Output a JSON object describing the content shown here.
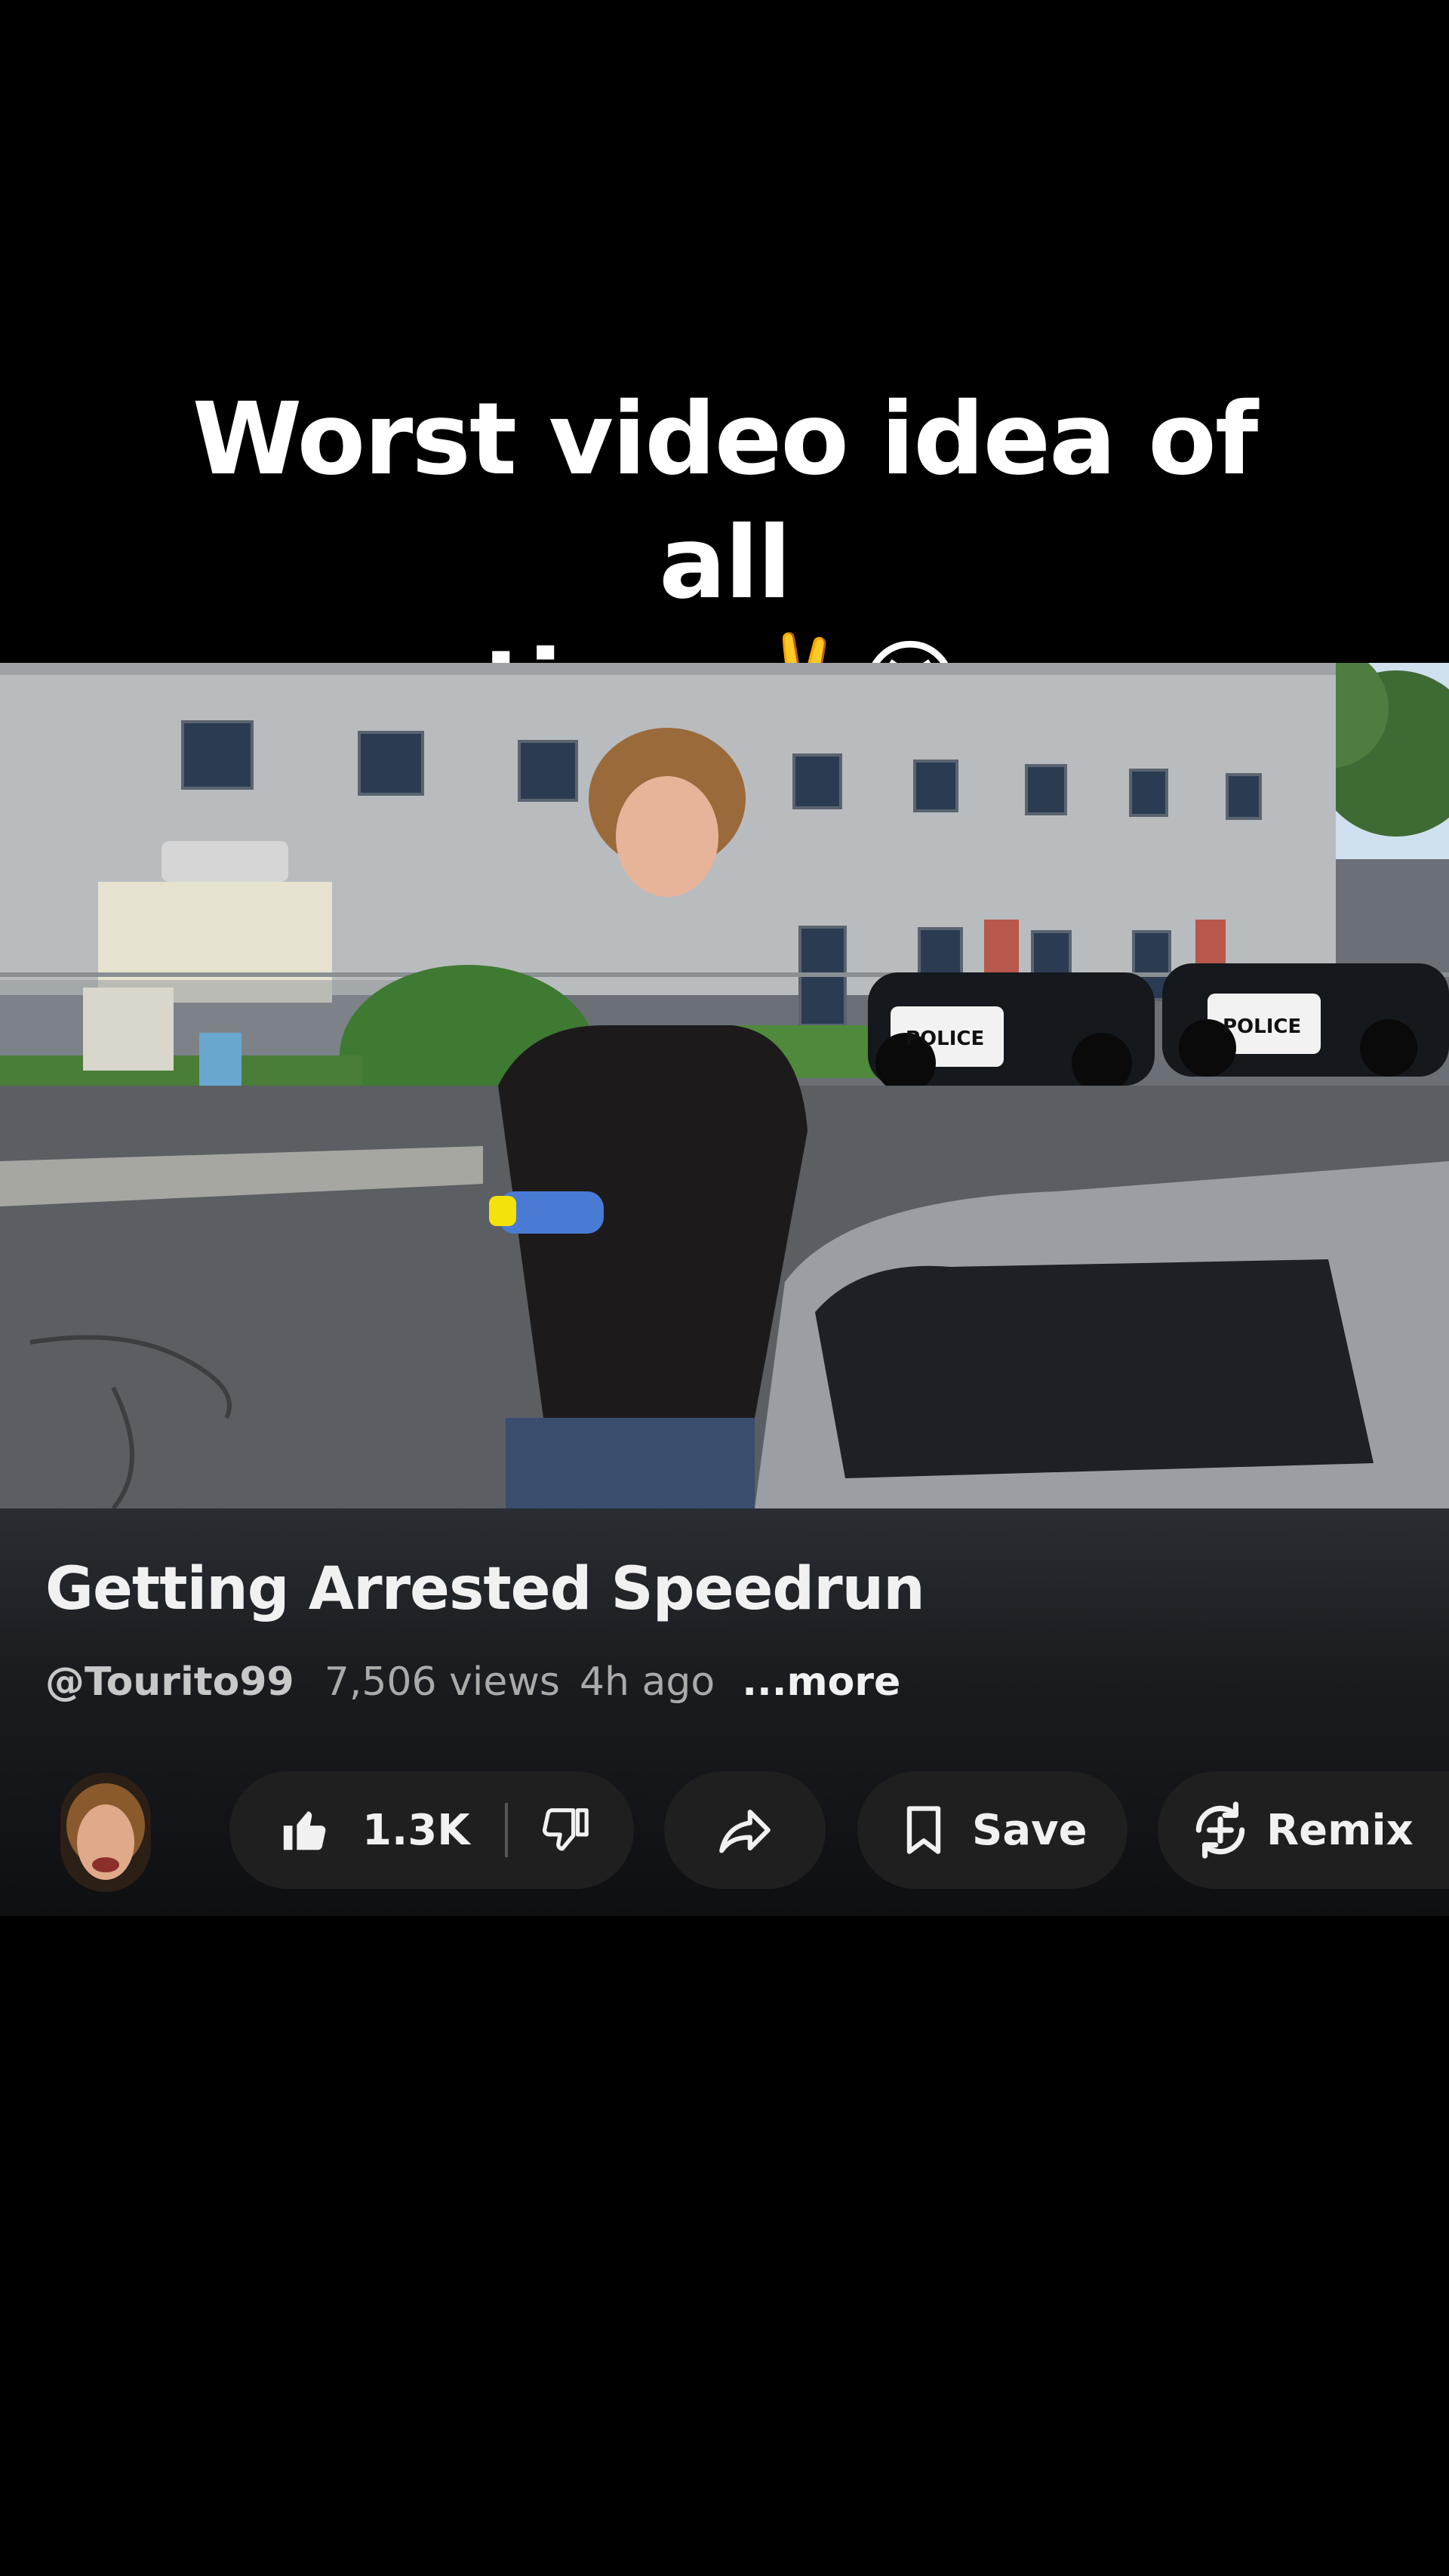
{
  "overlay_caption": {
    "line1": "Worst video idea of all",
    "line2_text": "time",
    "line2_emoji": "✌️😭"
  },
  "video": {
    "scene_text": {
      "police_left": "POLICE",
      "police_right": "POLICE"
    }
  },
  "info": {
    "title": "Getting Arrested Speedrun",
    "channel": "@Tourito99",
    "views": "7,506 views",
    "age": "4h ago",
    "more": "...more"
  },
  "actions": {
    "likes": "1.3K",
    "save": "Save",
    "remix": "Remix"
  },
  "colors": {
    "background": "#000000",
    "panel": "#1f1f1f",
    "text_primary": "#f1f1f1",
    "text_secondary": "#aaaaaa"
  },
  "icons": [
    "like-icon",
    "dislike-icon",
    "share-icon",
    "save-bookmark-icon",
    "remix-icon",
    "avatar"
  ]
}
